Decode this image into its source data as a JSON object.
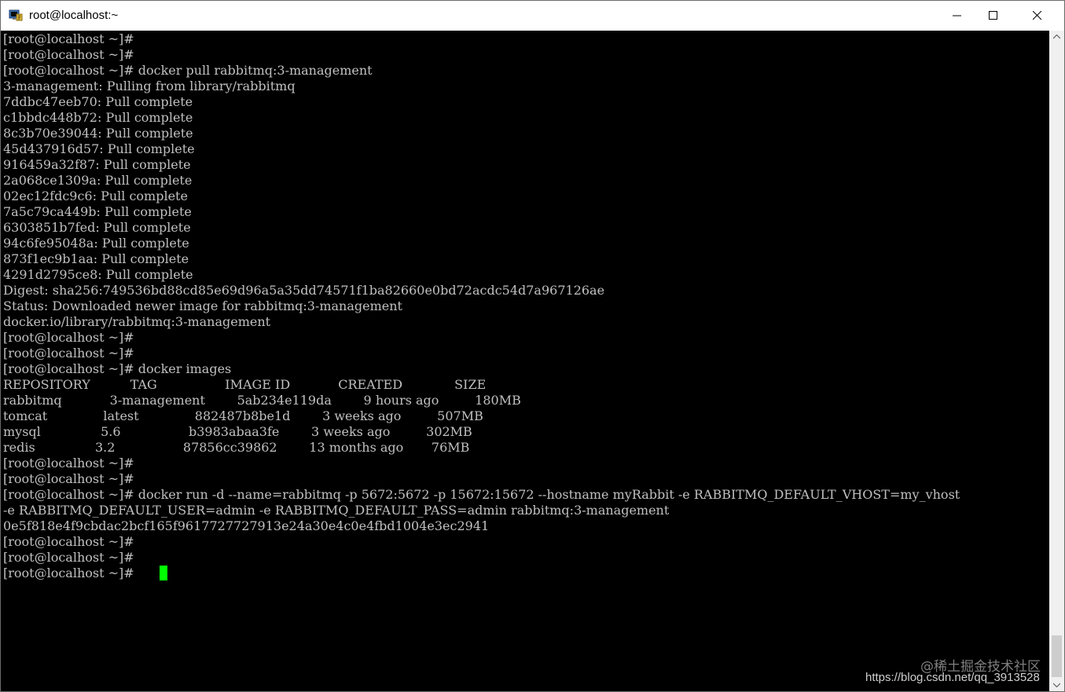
{
  "window": {
    "title": "root@localhost:~"
  },
  "icons": {
    "app": "terminal-app-icon",
    "minimize": "minimize-icon",
    "maximize": "maximize-icon",
    "close": "close-icon"
  },
  "terminal": {
    "lines": [
      "[root@localhost ~]#",
      "[root@localhost ~]#",
      "[root@localhost ~]# docker pull rabbitmq:3-management",
      "3-management: Pulling from library/rabbitmq",
      "7ddbc47eeb70: Pull complete",
      "c1bbdc448b72: Pull complete",
      "8c3b70e39044: Pull complete",
      "45d437916d57: Pull complete",
      "916459a32f87: Pull complete",
      "2a068ce1309a: Pull complete",
      "02ec12fdc9c6: Pull complete",
      "7a5c79ca449b: Pull complete",
      "6303851b7fed: Pull complete",
      "94c6fe95048a: Pull complete",
      "873f1ec9b1aa: Pull complete",
      "4291d2795ce8: Pull complete",
      "Digest: sha256:749536bd88cd85e69d96a5a35dd74571f1ba82660e0bd72acdc54d7a967126ae",
      "Status: Downloaded newer image for rabbitmq:3-management",
      "docker.io/library/rabbitmq:3-management",
      "[root@localhost ~]#",
      "[root@localhost ~]#",
      "[root@localhost ~]# docker images",
      "REPOSITORY          TAG                 IMAGE ID            CREATED             SIZE",
      "rabbitmq            3-management        5ab234e119da        9 hours ago         180MB",
      "tomcat              latest              882487b8be1d        3 weeks ago         507MB",
      "mysql               5.6                 b3983abaa3fe        3 weeks ago         302MB",
      "redis               3.2                 87856cc39862        13 months ago       76MB",
      "[root@localhost ~]#",
      "[root@localhost ~]#",
      "[root@localhost ~]# docker run -d --name=rabbitmq -p 5672:5672 -p 15672:15672 --hostname myRabbit -e RABBITMQ_DEFAULT_VHOST=my_vhost",
      "-e RABBITMQ_DEFAULT_USER=admin -e RABBITMQ_DEFAULT_PASS=admin rabbitmq:3-management",
      "0e5f818e4f9cbdac2bcf165f9617727727913e24a30e4c0e4fbd1004e3ec2941",
      "[root@localhost ~]#",
      "[root@localhost ~]#",
      "[root@localhost ~]# "
    ],
    "colors": {
      "background": "#000000",
      "foreground": "#c0c0c0",
      "cursor": "#00ff00"
    }
  },
  "watermark": {
    "line1": "@稀土掘金技术社区",
    "line2": "https://blog.csdn.net/qq_3913528"
  }
}
